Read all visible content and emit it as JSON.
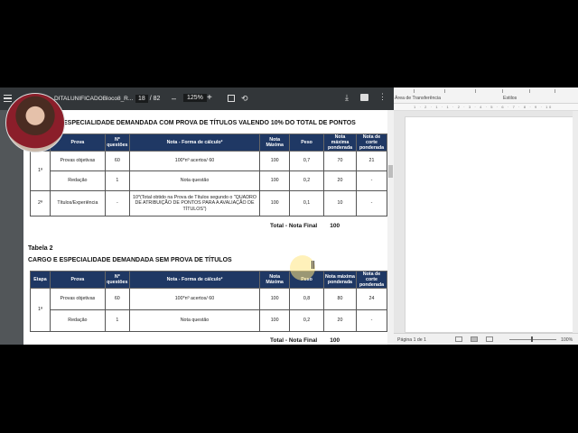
{
  "pdf": {
    "filename": "DITALUNIFICADOBloco8_R...",
    "page_current": "18",
    "page_sep": "/",
    "page_total": "82",
    "zoom": "125%",
    "zoom_out": "–",
    "zoom_in": "+",
    "download_glyph": "⤓",
    "rotate_glyph": "⟲",
    "more_glyph": "⋮"
  },
  "table1": {
    "title": "ESPECIALIDADE DEMANDADA COM PROVA DE TÍTULOS VALENDO 10% DO TOTAL DE PONTOS",
    "headers": [
      "Prova",
      "Nº questões",
      "Nota - Forma de cálculo²",
      "Nota Máxima",
      "Peso",
      "Nota máxima ponderada",
      "Nota de corte ponderada"
    ],
    "etapa1": "1ª",
    "etapa2": "2ª",
    "rows": [
      [
        "Provas objetivas",
        "60",
        "100*nº acertos/ 60",
        "100",
        "0,7",
        "70",
        "21"
      ],
      [
        "Redação",
        "1",
        "Nota questão",
        "100",
        "0,2",
        "20",
        "-"
      ],
      [
        "Títulos/Experiência",
        "-",
        "10*(Total obtido na Prova de Títulos segundo o \"QUADRO DE ATRIBUIÇÃO DE PONTOS PARA A AVALIAÇÃO DE TÍTULOS\")",
        "100",
        "0,1",
        "10",
        "-"
      ]
    ],
    "total_label": "Total - Nota Final",
    "total_value": "100"
  },
  "table2": {
    "caption": "Tabela 2",
    "title": "CARGO E ESPECIALIDADE DEMANDADA SEM PROVA DE TÍTULOS",
    "headers": [
      "Etapa",
      "Prova",
      "Nº questões",
      "Nota - Forma de cálculo²",
      "Nota Máxima",
      "Peso",
      "Nota máxima ponderada",
      "Nota de corte ponderada"
    ],
    "etapa": "1ª",
    "rows": [
      [
        "Provas objetivas",
        "60",
        "100*nº acertos/ 60",
        "100",
        "0,8",
        "80",
        "24"
      ],
      [
        "Redação",
        "1",
        "Nota questão",
        "100",
        "0,2",
        "20",
        "-"
      ]
    ],
    "total_label": "Total - Nota Final",
    "total_value": "100"
  },
  "word": {
    "ribbon_clipboard": "Área de Transferência",
    "ribbon_styles": "Estilos",
    "ruler_text": "1 · 2 · 1 · 1 · 2 · 3 · 4 · 5 · 6 · 7 · 8 · 9 · 10",
    "status_page": "Página 1 de 1",
    "status_zoom": "100%"
  },
  "colors": {
    "table_header": "#1f3864",
    "pdf_toolbar": "#323639",
    "pdf_background": "#525659"
  }
}
